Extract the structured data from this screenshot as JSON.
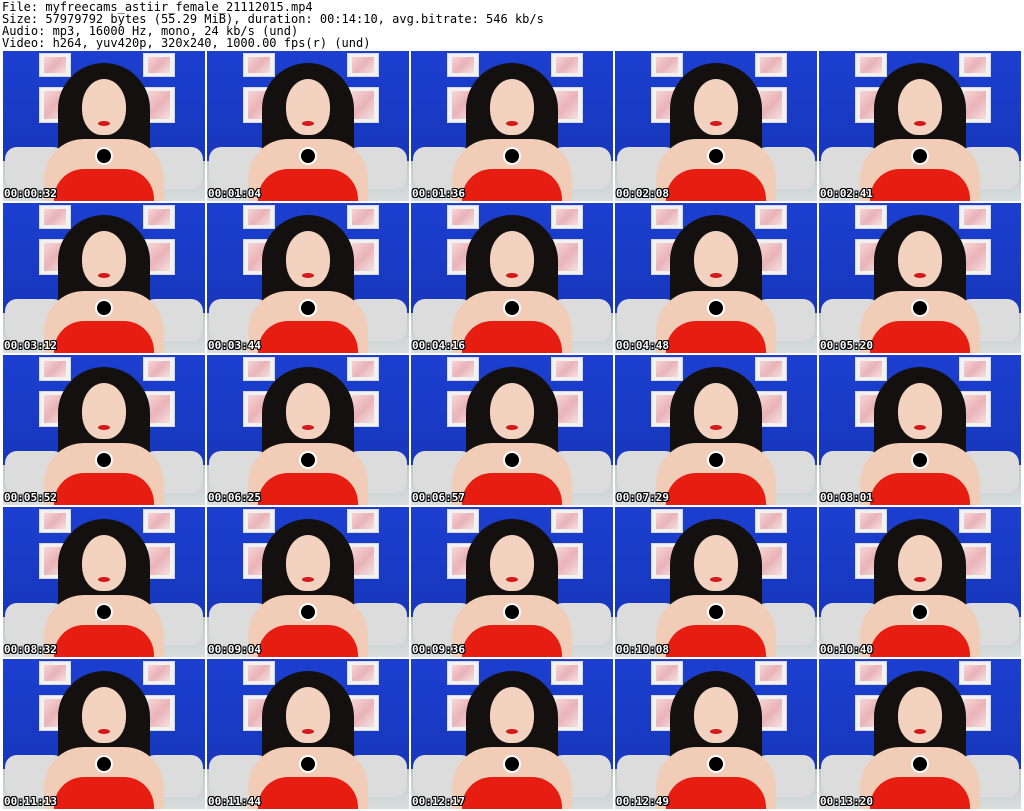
{
  "header": {
    "file_line": "File: myfreecams_astiir_female_21112015.mp4",
    "size_line": "Size: 57979792 bytes (55.29 MiB), duration: 00:14:10, avg.bitrate: 546 kb/s",
    "audio_line": "Audio: mp3, 16000 Hz, mono, 24 kb/s (und)",
    "video_line": "Video: h264, yuv420p, 320x240, 1000.00 fps(r) (und)"
  },
  "thumbnails": [
    {
      "timestamp": "00:00:32"
    },
    {
      "timestamp": "00:01:04"
    },
    {
      "timestamp": "00:01:36"
    },
    {
      "timestamp": "00:02:08"
    },
    {
      "timestamp": "00:02:41"
    },
    {
      "timestamp": "00:03:12"
    },
    {
      "timestamp": "00:03:44"
    },
    {
      "timestamp": "00:04:16"
    },
    {
      "timestamp": "00:04:48"
    },
    {
      "timestamp": "00:05:20"
    },
    {
      "timestamp": "00:05:52"
    },
    {
      "timestamp": "00:06:25"
    },
    {
      "timestamp": "00:06:57"
    },
    {
      "timestamp": "00:07:29"
    },
    {
      "timestamp": "00:08:01"
    },
    {
      "timestamp": "00:08:32"
    },
    {
      "timestamp": "00:09:04"
    },
    {
      "timestamp": "00:09:36"
    },
    {
      "timestamp": "00:10:08"
    },
    {
      "timestamp": "00:10:40"
    },
    {
      "timestamp": "00:11:13"
    },
    {
      "timestamp": "00:11:44"
    },
    {
      "timestamp": "00:12:17"
    },
    {
      "timestamp": "00:12:49"
    },
    {
      "timestamp": "00:13:20"
    }
  ]
}
